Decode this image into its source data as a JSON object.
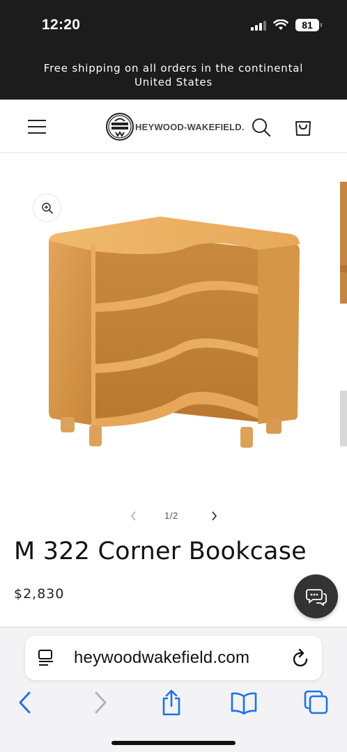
{
  "status_bar": {
    "time": "12:20",
    "battery": "81",
    "icons": [
      "signal-icon",
      "wifi-icon",
      "battery-icon"
    ]
  },
  "announcement": {
    "line1": "Free shipping on all orders in the continental",
    "line2": "United States"
  },
  "header": {
    "brand": "HEYWOOD-WAKEFIELD.",
    "icons": [
      "menu-icon",
      "search-icon",
      "cart-icon"
    ]
  },
  "gallery": {
    "counter": "1/2",
    "icons": [
      "zoom-icon",
      "chevron-left-icon",
      "chevron-right-icon"
    ]
  },
  "product": {
    "title": "M 322 Corner Bookcase",
    "price": "$2,830"
  },
  "safari": {
    "url": "heywoodwakefield.com",
    "icons": [
      "reader-icon",
      "reload-icon",
      "back-icon",
      "forward-icon",
      "share-icon",
      "bookmarks-icon",
      "tabs-icon"
    ]
  },
  "colors": {
    "top_bar": "#1c1c1c",
    "ios_blue": "#1a73e8",
    "wood": "#d99c4e",
    "chat_fab": "#333333"
  }
}
